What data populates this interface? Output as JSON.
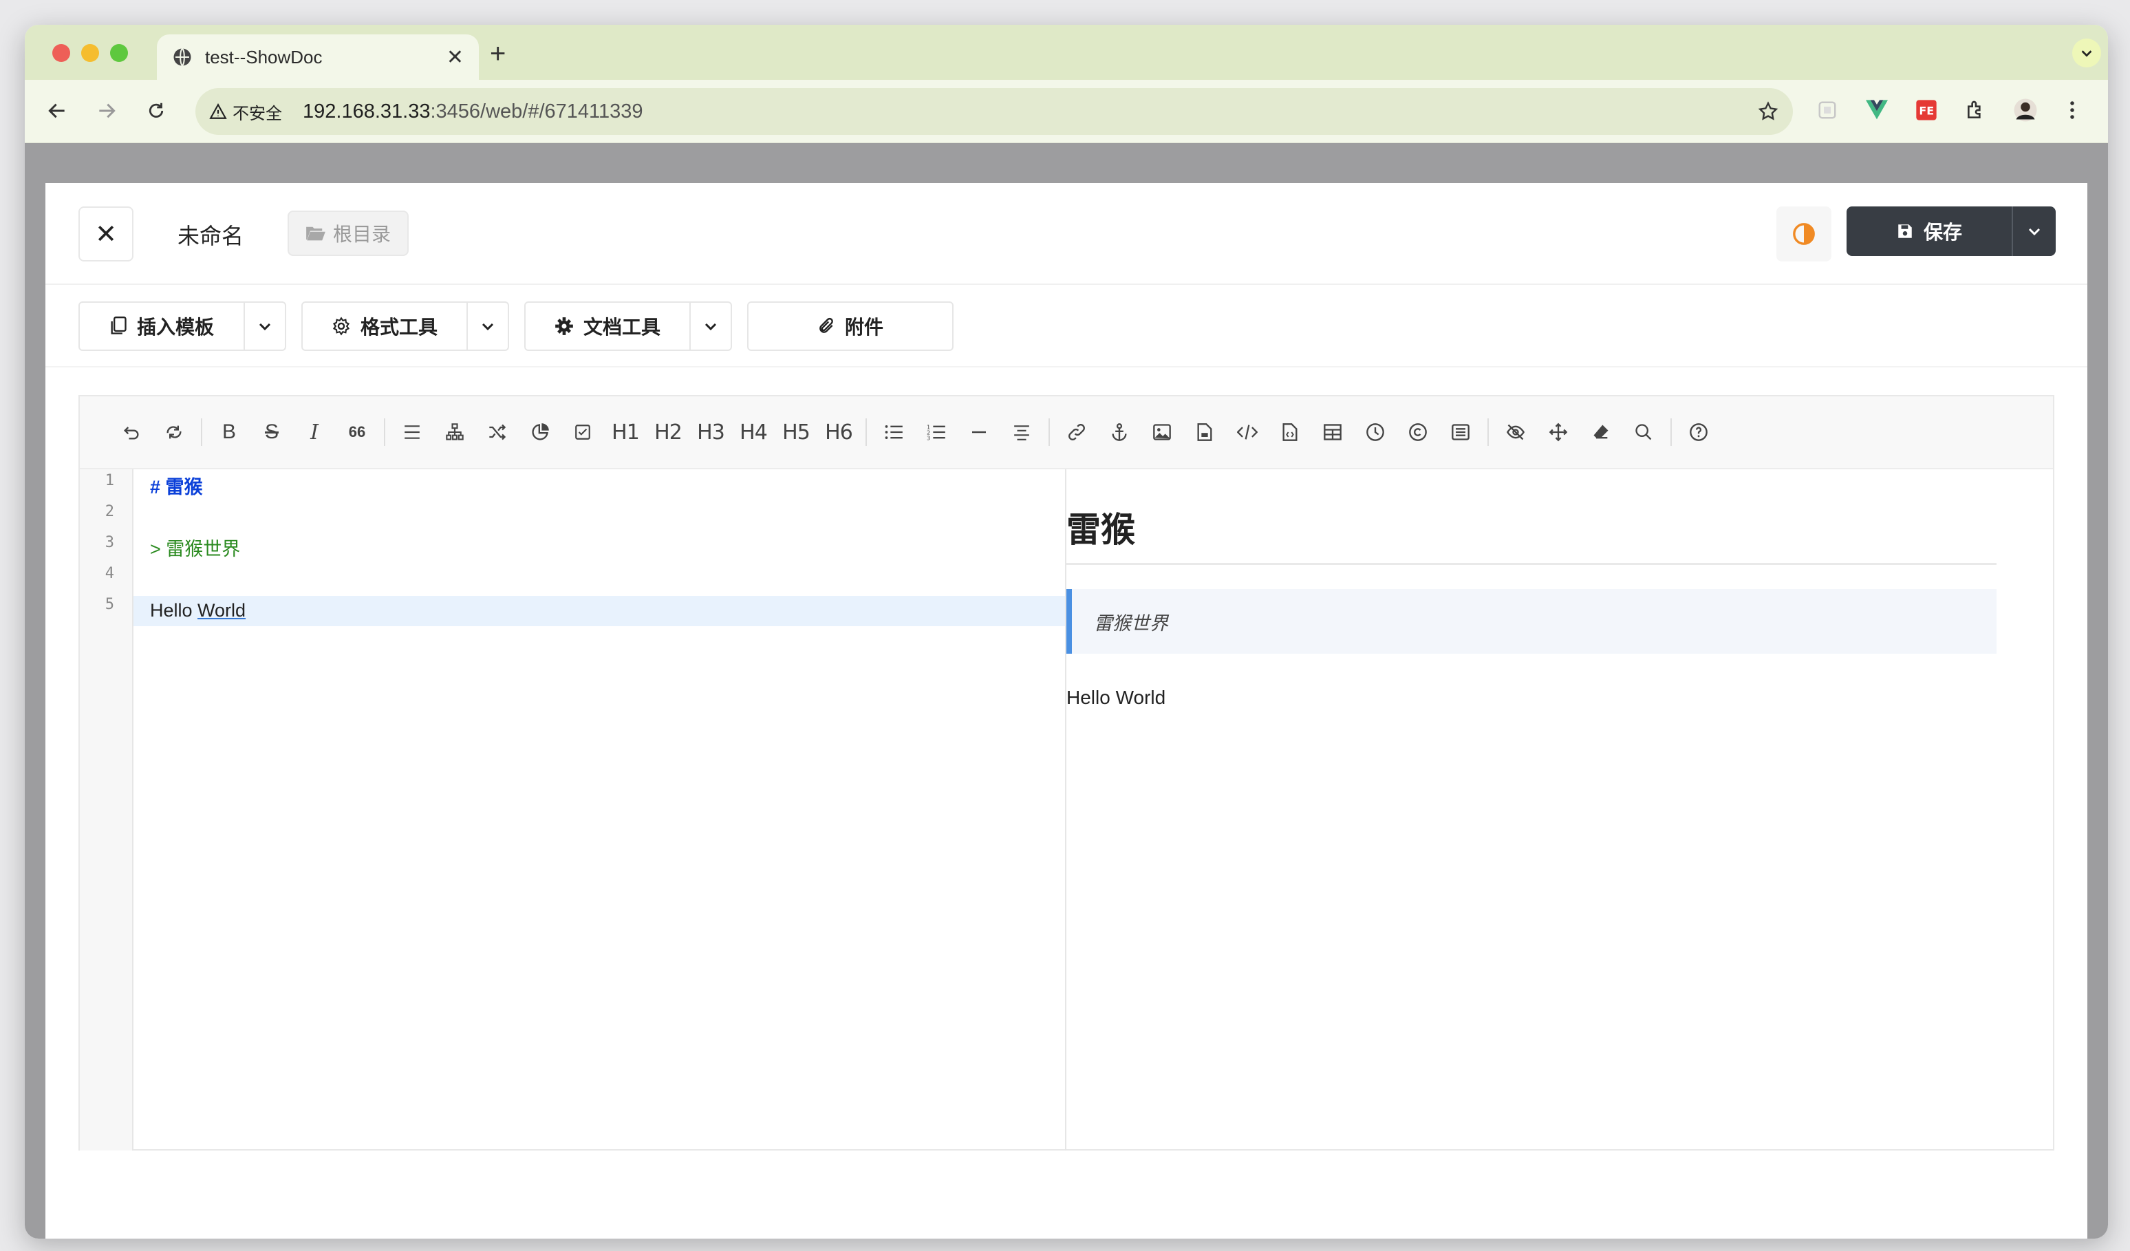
{
  "browser": {
    "tab_title": "test--ShowDoc",
    "insecure_label": "不安全",
    "url_host": "192.168.31.33",
    "url_path": ":3456/web/#/671411339"
  },
  "doc": {
    "title": "未命名",
    "folder_label": "根目录",
    "save_label": "保存"
  },
  "tools": {
    "insert_template": "插入模板",
    "format_tools": "格式工具",
    "doc_tools": "文档工具",
    "attachment": "附件"
  },
  "toolbar_headings": [
    "H1",
    "H2",
    "H3",
    "H4",
    "H5",
    "H6"
  ],
  "quote_icon_text": "66",
  "editor": {
    "line_numbers": [
      "1",
      "2",
      "3",
      "4",
      "5"
    ],
    "lines": [
      "# 雷猴",
      "",
      "> 雷猴世界",
      "",
      "Hello World"
    ],
    "line5_a": "Hello ",
    "line5_b": "World"
  },
  "preview": {
    "h1": "雷猴",
    "blockquote": "雷猴世界",
    "paragraph": "Hello World"
  },
  "colors": {
    "accent_blue": "#4a90e2",
    "save_bg": "#383d44",
    "heading_code": "#0b40d9",
    "quote_code": "#2a8a1f",
    "theme_orange": "#f08a24"
  }
}
